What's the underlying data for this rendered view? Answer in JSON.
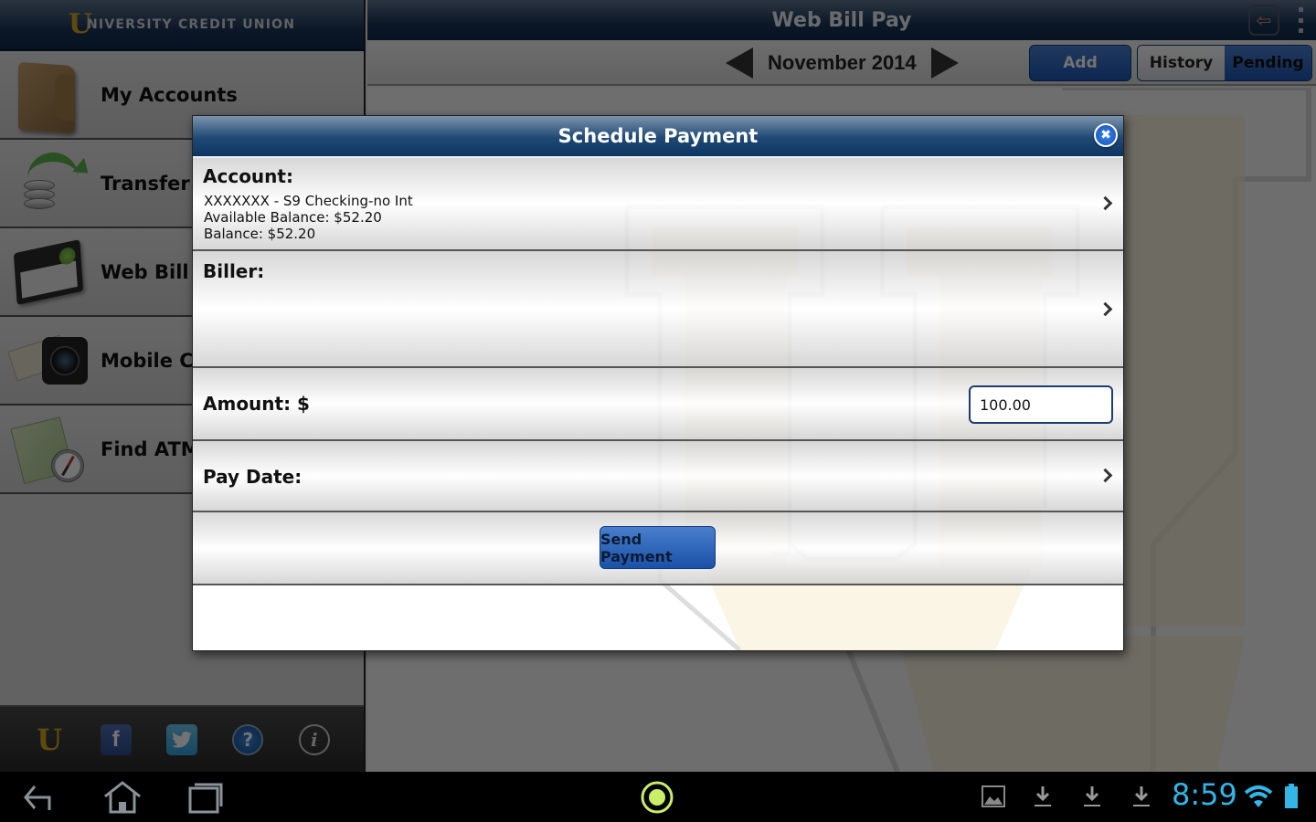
{
  "sidebar": {
    "brand": {
      "logo_letter": "U",
      "name": "NIVERSITY CREDIT UNION"
    },
    "items": [
      {
        "label": "My Accounts",
        "icon": "wallet-icon"
      },
      {
        "label": "Transfer F",
        "icon": "transfer-coins-icon"
      },
      {
        "label": "Web Bill P",
        "icon": "checkbook-icon"
      },
      {
        "label": "Mobile Ch",
        "icon": "camera-check-icon"
      },
      {
        "label": "Find ATM",
        "icon": "map-compass-icon"
      }
    ],
    "footer": {
      "u_label": "U",
      "facebook_label": "f",
      "twitter_label": "🐦",
      "help_label": "?",
      "info_label": "i"
    }
  },
  "main": {
    "title": "Web Bill Pay",
    "logout_label": "⇦",
    "month": "November 2014",
    "add_label": "Add",
    "tabs": [
      {
        "label": "History",
        "selected": false
      },
      {
        "label": "Pending",
        "selected": true
      }
    ]
  },
  "modal": {
    "title": "Schedule Payment",
    "close_label": "✖",
    "account": {
      "label": "Account:",
      "name": "XXXXXXX - S9 Checking-no Int",
      "available_balance": "Available Balance: $52.20",
      "balance": "Balance: $52.20"
    },
    "biller": {
      "label": "Biller:"
    },
    "amount": {
      "label": "Amount: $",
      "value": "100.00"
    },
    "pay_date": {
      "label": "Pay Date:"
    },
    "send_label": "Send Payment"
  },
  "status_bar": {
    "time": "8:59",
    "icons": [
      "gallery-icon",
      "download-icon",
      "download-icon",
      "download-icon",
      "wifi-icon",
      "battery-icon"
    ]
  },
  "colors": {
    "header_navy": "#1a3556",
    "brand_gold": "#d2a520",
    "button_blue": "#1c56b3",
    "clock_blue": "#33b5e5"
  }
}
